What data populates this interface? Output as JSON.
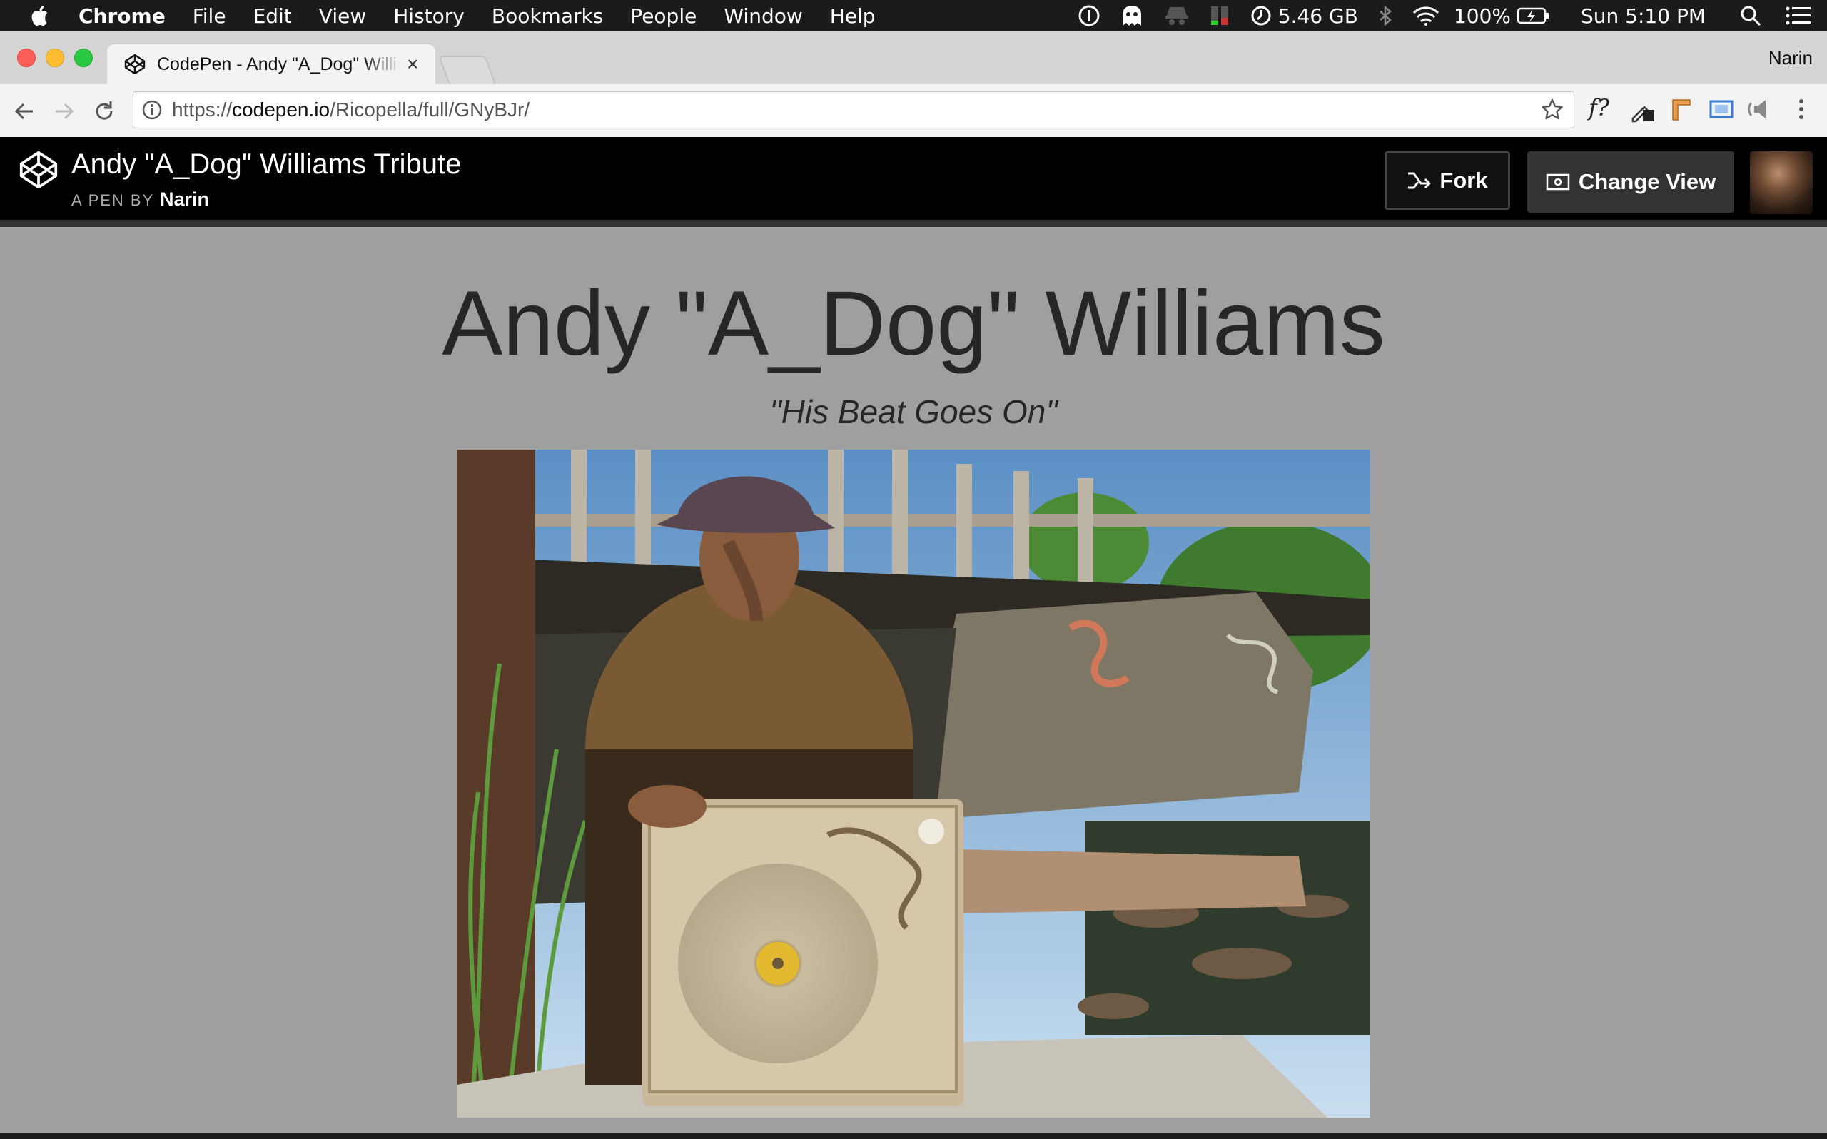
{
  "menubar": {
    "app_name": "Chrome",
    "items": [
      "File",
      "Edit",
      "View",
      "History",
      "Bookmarks",
      "People",
      "Window",
      "Help"
    ],
    "memory": "5.46 GB",
    "battery": "100%",
    "clock": "Sun 5:10 PM"
  },
  "browser": {
    "tab_title": "CodePen - Andy \"A_Dog\" Williams Tribute",
    "tab_close": "×",
    "profile_name": "Narin",
    "url_scheme": "https://",
    "url_host": "codepen.io",
    "url_path": "/Ricopella/full/GNyBJr/",
    "ext_fquery": "f?"
  },
  "codepen": {
    "pen_title": "Andy \"A_Dog\" Williams Tribute",
    "byline_prefix": "A PEN BY",
    "author": "Narin",
    "fork_label": "Fork",
    "change_view_label": "Change View"
  },
  "page": {
    "heading": "Andy \"A_Dog\" Williams",
    "tagline": "\"His Beat Goes On\""
  },
  "colors": {
    "page_background": "#9f9f9f",
    "header_background": "#000000",
    "heading_text": "#262626"
  }
}
